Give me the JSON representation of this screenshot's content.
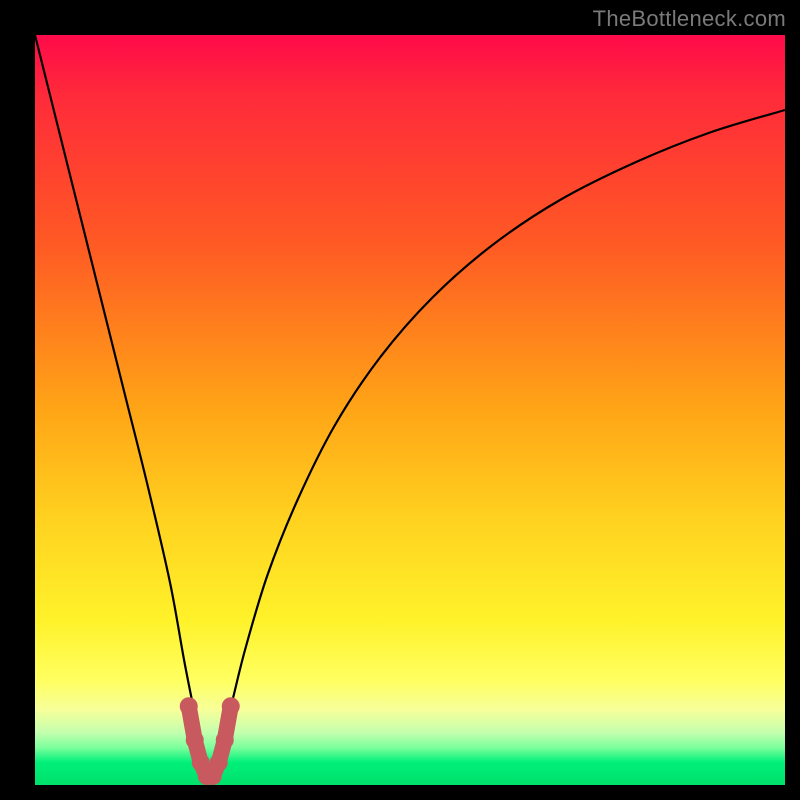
{
  "watermark": "TheBottleneck.com",
  "colors": {
    "page_bg": "#000000",
    "watermark": "#7a7a7a",
    "curve_stroke": "#000000",
    "marker_fill": "#c85a5f",
    "marker_stroke": "#c85a5f"
  },
  "chart_data": {
    "type": "line",
    "title": "",
    "xlabel": "",
    "ylabel": "",
    "xlim": [
      0,
      100
    ],
    "ylim": [
      0,
      100
    ],
    "grid": false,
    "legend": false,
    "note": "Bottleneck-style V-curve; background gradient encodes severity (red high → green low). Minimum of the curve lies at roughly x≈23 near y≈0. Axes have no visible tick labels; values below are read off the plot proportionally, precision ±2.",
    "series": [
      {
        "name": "curve",
        "x": [
          0,
          3,
          6,
          9,
          12,
          15,
          18,
          20,
          22,
          23,
          24,
          26,
          28,
          31,
          35,
          40,
          46,
          53,
          61,
          70,
          80,
          90,
          100
        ],
        "y": [
          100,
          88,
          76,
          64,
          52,
          40,
          27,
          16,
          6,
          1,
          3,
          10,
          18,
          28,
          38,
          48,
          57,
          65,
          72,
          78,
          83,
          87,
          90
        ]
      }
    ],
    "markers": {
      "name": "bottom-highlight",
      "description": "Short U-shaped segment of thick rounded dots at the curve minimum",
      "x": [
        20.5,
        21.3,
        22.1,
        22.9,
        23.7,
        24.5,
        25.3,
        26.1
      ],
      "y": [
        10.5,
        6.0,
        3.0,
        1.2,
        1.2,
        3.0,
        6.0,
        10.5
      ]
    }
  }
}
